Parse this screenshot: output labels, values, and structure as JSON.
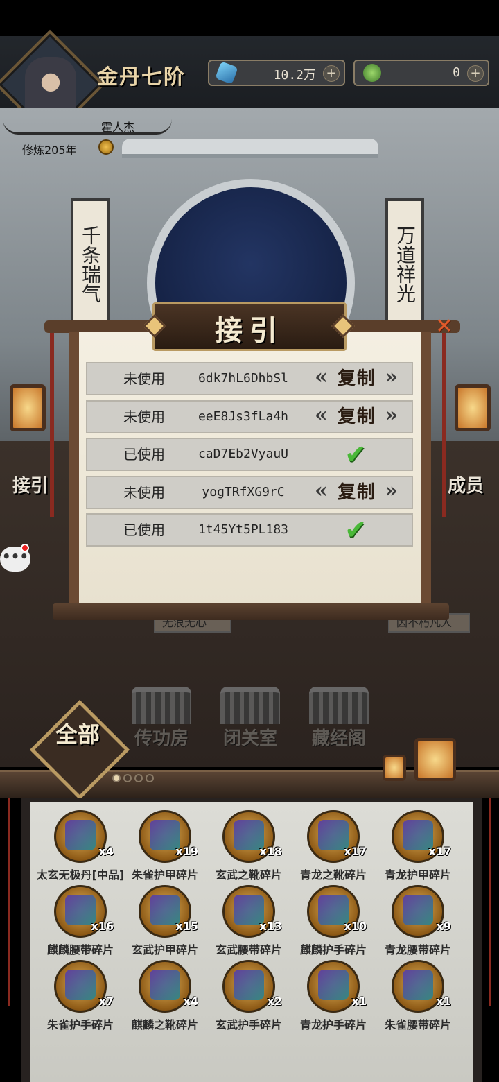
{
  "header": {
    "rank": "金丹七阶",
    "gems": "10.2万",
    "jade": "0",
    "plus": "+",
    "player_name": "霍人杰",
    "cultivation": "修炼205年"
  },
  "scene": {
    "couplet_left": "千条瑞气",
    "couplet_right": "万道祥光",
    "side_left": "接引",
    "side_right": "成员",
    "chat": "•••",
    "ghost_left": "无浪无心",
    "ghost_right": "因不朽凡人"
  },
  "dialog": {
    "title": "接引",
    "close": "✕",
    "copy_label": "复制",
    "check": "✔",
    "codes": [
      {
        "status": "未使用",
        "code": "6dk7hL6DhbSl",
        "used": false
      },
      {
        "status": "未使用",
        "code": "eeE8Js3fLa4h",
        "used": false
      },
      {
        "status": "已使用",
        "code": "caD7Eb2VyauU",
        "used": true
      },
      {
        "status": "未使用",
        "code": "yogTRfXG9rC",
        "used": false
      },
      {
        "status": "已使用",
        "code": "1t45Yt5PL183",
        "used": true
      }
    ]
  },
  "buildings": {
    "all": "全部",
    "items": [
      "传功房",
      "闭关室",
      "藏经阁"
    ]
  },
  "inventory": {
    "items": [
      {
        "name": "太玄无极丹[中品]",
        "count": "x4"
      },
      {
        "name": "朱雀护甲碎片",
        "count": "x19"
      },
      {
        "name": "玄武之靴碎片",
        "count": "x18"
      },
      {
        "name": "青龙之靴碎片",
        "count": "x17"
      },
      {
        "name": "青龙护甲碎片",
        "count": "x17"
      },
      {
        "name": "麒麟腰带碎片",
        "count": "x16"
      },
      {
        "name": "玄武护甲碎片",
        "count": "x15"
      },
      {
        "name": "玄武腰带碎片",
        "count": "x13"
      },
      {
        "name": "麒麟护手碎片",
        "count": "x10"
      },
      {
        "name": "青龙腰带碎片",
        "count": "x9"
      },
      {
        "name": "朱雀护手碎片",
        "count": "x7"
      },
      {
        "name": "麒麟之靴碎片",
        "count": "x4"
      },
      {
        "name": "玄武护手碎片",
        "count": "x2"
      },
      {
        "name": "青龙护手碎片",
        "count": "x1"
      },
      {
        "name": "朱雀腰带碎片",
        "count": "x1"
      }
    ]
  }
}
